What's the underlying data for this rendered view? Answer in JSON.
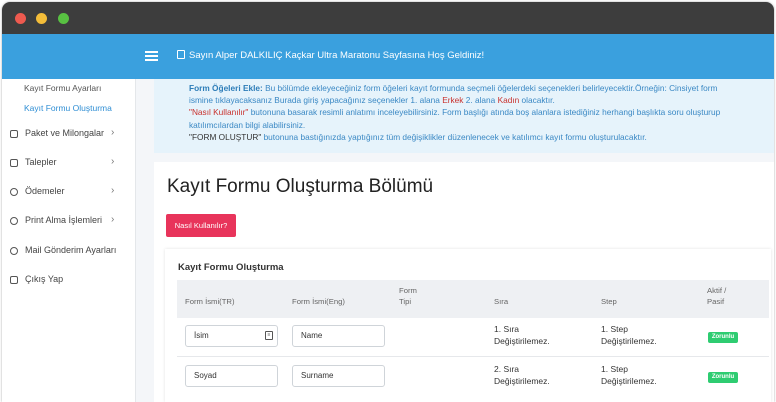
{
  "header": {
    "welcome": "Sayın Alper DALKILIÇ Kaçkar Ultra Maratonu Sayfasına Hoş Geldiniz!"
  },
  "sidebar": {
    "sub_items": [
      {
        "label": "Kayıt Formu Ayarları"
      },
      {
        "label": "Kayıt Formu Oluşturma"
      }
    ],
    "items": [
      {
        "label": "Paket ve Milongalar",
        "icon": "box-icon"
      },
      {
        "label": "Talepler",
        "icon": "request-icon"
      },
      {
        "label": "Ödemeler",
        "icon": "coin-icon"
      },
      {
        "label": "Print Alma İşlemleri",
        "icon": "globe-icon"
      },
      {
        "label": "Mail Gönderim Ayarları",
        "icon": "gear-icon"
      },
      {
        "label": "Çıkış Yap",
        "icon": "logout-icon"
      }
    ]
  },
  "info": {
    "l1_title": "Form Öğeleri Ekle:",
    "l1_text": " Bu bölümde ekleyeceğiniz form öğeleri kayıt formunda seçmeli öğelerdeki seçenekleri belirleyecektir.Örneğin: Cinsiyet form",
    "l2_a": "ismine tıklayacaksanız Burada giriş yapacağınız seçenekler 1. alana ",
    "l2_b": "Erkek",
    "l2_c": " 2. alana ",
    "l2_d": "Kadın",
    "l2_e": " olacaktır.",
    "l3_a": "\"Nasıl Kullanılır\"",
    "l3_b": " butonuna basarak resimli anlatımı inceleyebilirsiniz. Form başlığı atında boş alanlara istediğiniz herhangi başlıkta soru oluşturup",
    "l4": "katılımcılardan bilgi alabilirsiniz.",
    "l5_a": "\"FORM OLUŞTUR\"",
    "l5_b": " butonuna bastığınızda yaptığınız tüm değişiklikler düzenlenecek ve katılımcı kayıt formu oluşturulacaktır."
  },
  "main": {
    "title": "Kayıt Formu Oluşturma Bölümü",
    "help_button": "Nasıl Kullanılır?"
  },
  "table": {
    "title": "Kayıt Formu Oluşturma",
    "headers": {
      "name_tr": "Form İsmi(TR)",
      "name_en": "Form İsmi(Eng)",
      "type_1": "Form",
      "type_2": "Tipi",
      "order": "Sıra",
      "step": "Step",
      "active_1": "Aktif /",
      "active_2": "Pasif"
    },
    "rows": [
      {
        "tr": "İsim",
        "en": "Name",
        "order_1": "1. Sıra",
        "order_2": "Değiştirilemez.",
        "step_1": "1. Step",
        "step_2": "Değiştirilemez.",
        "badge": "Zorunlu"
      },
      {
        "tr": "Soyad",
        "en": "Surname",
        "order_1": "2. Sıra",
        "order_2": "Değiştirilemez.",
        "step_1": "1. Step",
        "step_2": "Değiştirilemez.",
        "badge": "Zorunlu"
      }
    ]
  },
  "colors": {
    "header": "#3aa0de",
    "help_button": "#e8345b",
    "badge": "#2ecc71",
    "info_bg": "#e6f3fb"
  }
}
